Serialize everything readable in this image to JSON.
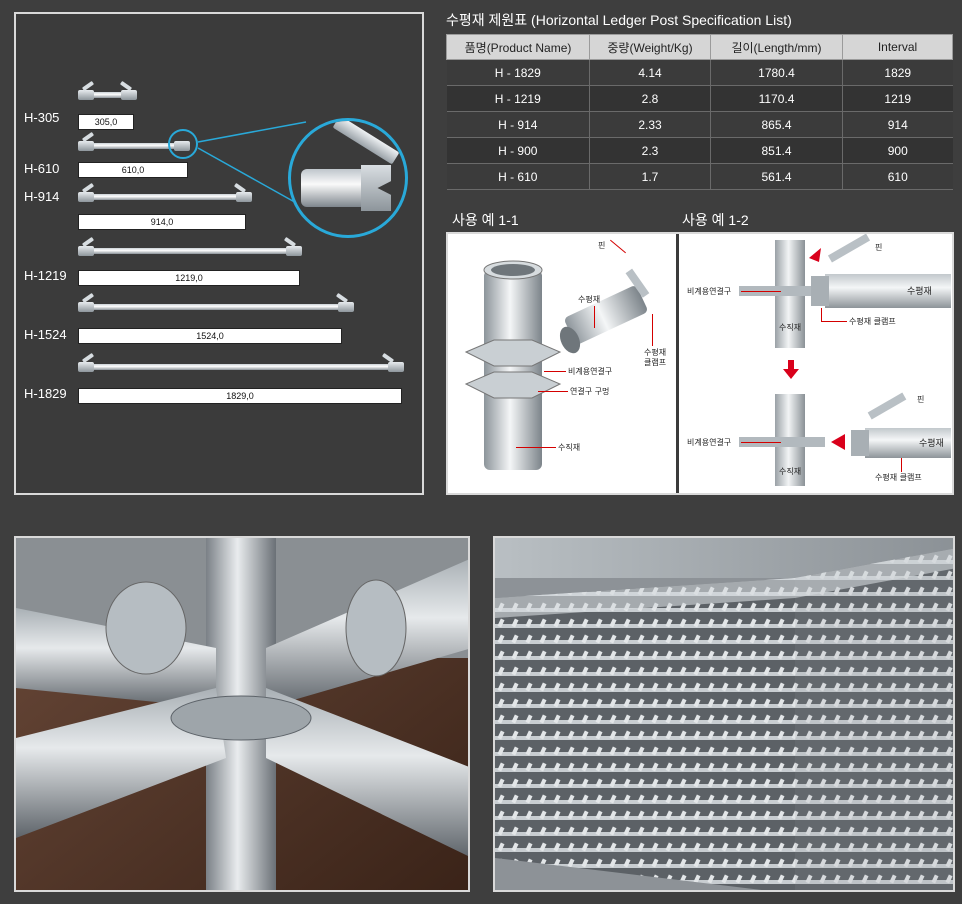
{
  "ledgers": [
    {
      "label": "H-305",
      "dim": "305,0"
    },
    {
      "label": "H-610",
      "dim": "610,0"
    },
    {
      "label": "H-914",
      "dim": "914,0"
    },
    {
      "label": "H-1219",
      "dim": "1219,0"
    },
    {
      "label": "H-1524",
      "dim": "1524,0"
    },
    {
      "label": "H-1829",
      "dim": "1829,0"
    }
  ],
  "spec": {
    "title": "수평재 제원표 (Horizontal Ledger Post Specification List)",
    "headers": [
      "품명(Product Name)",
      "중량(Weight/Kg)",
      "길이(Length/mm)",
      "Interval"
    ],
    "rows": [
      [
        "H - 1829",
        "4.14",
        "1780.4",
        "1829"
      ],
      [
        "H - 1219",
        "2.8",
        "1170.4",
        "1219"
      ],
      [
        "H - 914",
        "2.33",
        "865.4",
        "914"
      ],
      [
        "H - 900",
        "2.3",
        "851.4",
        "900"
      ],
      [
        "H - 610",
        "1.7",
        "561.4",
        "610"
      ]
    ]
  },
  "usage": {
    "title1": "사용 예 1-1",
    "title2": "사용 예 1-2",
    "ex1": {
      "pin": "핀",
      "horizontal": "수평재",
      "clamp": "수평재\n클램프",
      "connector": "비계용연결구",
      "hole": "연결구 구멍",
      "vertical": "수직재"
    },
    "ex2": {
      "pin": "핀",
      "connector": "비계용연결구",
      "horizontal": "수평재",
      "vertical": "수직재",
      "clamp": "수평재 클램프"
    }
  },
  "colors": {
    "accent_ring": "#29a9d9",
    "annotation_red": "#d40000",
    "arrow_red": "#d9001b"
  }
}
